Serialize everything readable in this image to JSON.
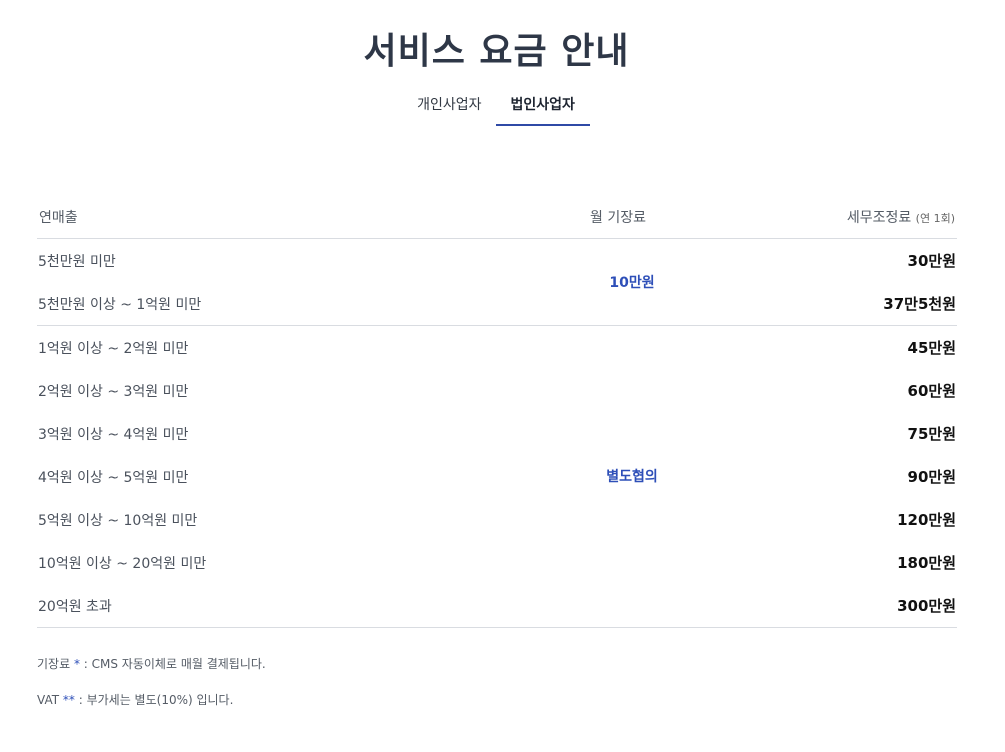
{
  "title": "서비스 요금 안내",
  "tabs": [
    {
      "label": "개인사업자",
      "active": false
    },
    {
      "label": "법인사업자",
      "active": true
    }
  ],
  "colors": {
    "accent": "#2e4fb8",
    "tab_underline": "#2f4aa6",
    "title": "#2e3747"
  },
  "table": {
    "headers": {
      "revenue": "연매출",
      "monthly": "월 기장료",
      "adjustment": "세무조정료",
      "adjustment_note": "(연 1회)"
    },
    "group1": {
      "monthly": "10만원",
      "rows": [
        {
          "range": "5천만원 미만",
          "fee": "30만원"
        },
        {
          "range": "5천만원 이상 ~ 1억원 미만",
          "fee": "37만5천원"
        }
      ]
    },
    "group2": {
      "monthly": "별도협의",
      "rows": [
        {
          "range": "1억원 이상 ~ 2억원 미만",
          "fee": "45만원"
        },
        {
          "range": "2억원 이상 ~ 3억원 미만",
          "fee": "60만원"
        },
        {
          "range": "3억원 이상 ~ 4억원 미만",
          "fee": "75만원"
        },
        {
          "range": "4억원 이상 ~ 5억원 미만",
          "fee": "90만원"
        },
        {
          "range": "5억원 이상 ~ 10억원 미만",
          "fee": "120만원"
        },
        {
          "range": "10억원 이상 ~ 20억원 미만",
          "fee": "180만원"
        },
        {
          "range": "20억원 초과",
          "fee": "300만원"
        }
      ]
    }
  },
  "notes": [
    {
      "label": "기장료",
      "star": "*",
      "text": ": CMS 자동이체로 매월 결제됩니다."
    },
    {
      "label": "VAT",
      "star": "**",
      "text": ": 부가세는 별도(10%) 입니다."
    }
  ]
}
